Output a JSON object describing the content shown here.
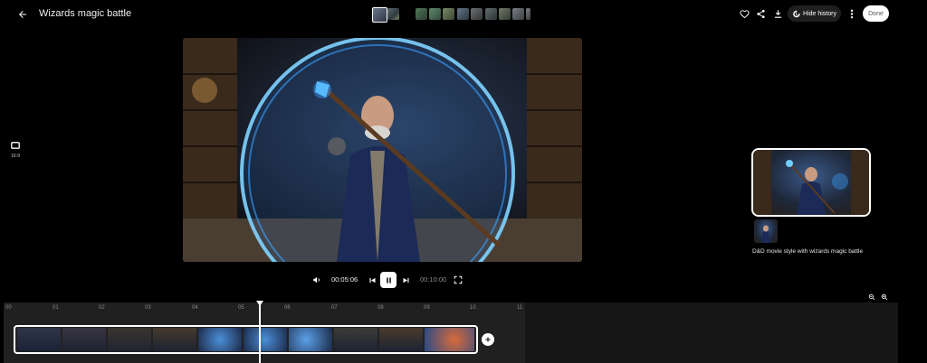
{
  "header": {
    "title": "Wizards magic battle",
    "hide_history_label": "Hide history",
    "done_label": "Done"
  },
  "left_panel": {
    "aspect_ratio": "16:9"
  },
  "player": {
    "current_time": "00:05:06",
    "total_time": "00:10:00"
  },
  "history": {
    "caption": "D&D movie style with wizards magic battle"
  },
  "timeline": {
    "ticks": [
      "00",
      "01",
      "02",
      "03",
      "04",
      "05",
      "06",
      "07",
      "08",
      "09",
      "10",
      "11"
    ],
    "playhead_seconds": 5.6,
    "clip_count": 10
  },
  "colors": {
    "background": "#000000",
    "accent_blue": "#3aa0ff",
    "panel": "#1f1f1f"
  }
}
